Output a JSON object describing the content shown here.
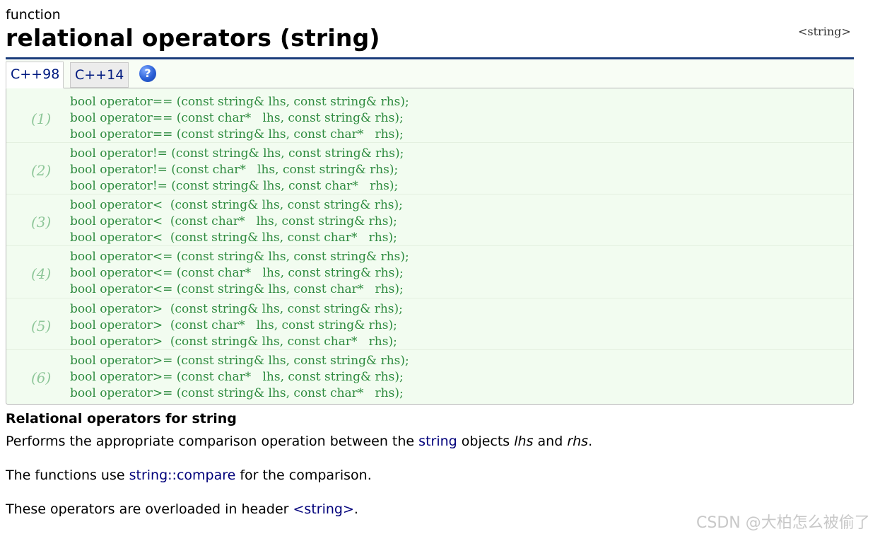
{
  "kind": "function",
  "title": "relational operators (string)",
  "header_link": "<string>",
  "tabs": [
    {
      "label": "C++98"
    },
    {
      "label": "C++14"
    }
  ],
  "help_icon": "?",
  "groups": [
    {
      "num": "(1)",
      "lines": [
        "bool operator== (const string& lhs, const string& rhs);",
        "bool operator== (const char*   lhs, const string& rhs);",
        "bool operator== (const string& lhs, const char*   rhs);"
      ]
    },
    {
      "num": "(2)",
      "lines": [
        "bool operator!= (const string& lhs, const string& rhs);",
        "bool operator!= (const char*   lhs, const string& rhs);",
        "bool operator!= (const string& lhs, const char*   rhs);"
      ]
    },
    {
      "num": "(3)",
      "lines": [
        "bool operator<  (const string& lhs, const string& rhs);",
        "bool operator<  (const char*   lhs, const string& rhs);",
        "bool operator<  (const string& lhs, const char*   rhs);"
      ]
    },
    {
      "num": "(4)",
      "lines": [
        "bool operator<= (const string& lhs, const string& rhs);",
        "bool operator<= (const char*   lhs, const string& rhs);",
        "bool operator<= (const string& lhs, const char*   rhs);"
      ]
    },
    {
      "num": "(5)",
      "lines": [
        "bool operator>  (const string& lhs, const string& rhs);",
        "bool operator>  (const char*   lhs, const string& rhs);",
        "bool operator>  (const string& lhs, const char*   rhs);"
      ]
    },
    {
      "num": "(6)",
      "lines": [
        "bool operator>= (const string& lhs, const string& rhs);",
        "bool operator>= (const char*   lhs, const string& rhs);",
        "bool operator>= (const string& lhs, const char*   rhs);"
      ]
    }
  ],
  "description": {
    "heading": "Relational operators for string",
    "p1": {
      "a": "Performs the appropriate comparison operation between the ",
      "link": "string",
      "b": " objects ",
      "lhs": "lhs",
      "c": " and ",
      "rhs": "rhs",
      "d": "."
    },
    "p2": {
      "a": "The functions use ",
      "link": "string::compare",
      "b": " for the comparison."
    },
    "p3": {
      "a": "These operators are overloaded in header ",
      "link": "<string>",
      "b": "."
    }
  },
  "watermark": "CSDN @大柏怎么被偷了"
}
